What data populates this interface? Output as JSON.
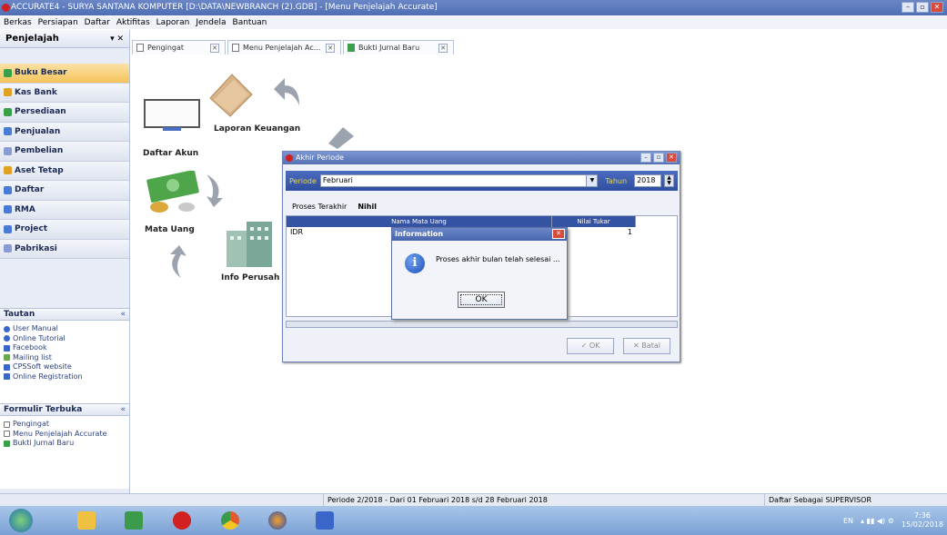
{
  "window": {
    "title": "ACCURATE4 - SURYA SANTANA KOMPUTER  [D:\\DATA\\NEWBRANCH (2).GDB] - [Menu Penjelajah Accurate]"
  },
  "menu": [
    "Berkas",
    "Persiapan",
    "Daftar",
    "Aktifitas",
    "Laporan",
    "Jendela",
    "Bantuan"
  ],
  "sidebar": {
    "title": "Penjelajah",
    "controls": "▾ ✕",
    "items": [
      {
        "label": "Buku Besar",
        "color": "#3aa04a"
      },
      {
        "label": "Kas Bank",
        "color": "#e0a020"
      },
      {
        "label": "Persediaan",
        "color": "#3aa04a"
      },
      {
        "label": "Penjualan",
        "color": "#4a7bd4"
      },
      {
        "label": "Pembelian",
        "color": "#8a9ccf"
      },
      {
        "label": "Aset Tetap",
        "color": "#e0a020"
      },
      {
        "label": "Daftar",
        "color": "#4a7bd4"
      },
      {
        "label": "RMA",
        "color": "#4a7bd4"
      },
      {
        "label": "Project",
        "color": "#4a7bd4"
      },
      {
        "label": "Pabrikasi",
        "color": "#8a9ccf"
      }
    ],
    "tautan": {
      "title": "Tautan",
      "links": [
        "User Manual",
        "Online Tutorial",
        "Facebook",
        "Mailing list",
        "CPSSoft website",
        "Online Registration"
      ]
    },
    "formulir": {
      "title": "Formulir Terbuka",
      "links": [
        "Pengingat",
        "Menu Penjelajah Accurate",
        "Bukti Jurnal Baru"
      ]
    }
  },
  "tabs": [
    "Pengingat",
    "Menu Penjelajah Ac...",
    "Bukti Jurnal Baru"
  ],
  "workspace": {
    "labels": {
      "daftar_akun": "Daftar Akun",
      "laporan_keuangan": "Laporan Keuangan",
      "mata_uang": "Mata Uang",
      "info_perusahaan": "Info Perusah"
    }
  },
  "dialog": {
    "title": "Akhir Periode",
    "periode_label": "Periode",
    "periode_value": "Februari",
    "tahun_label": "Tahun",
    "tahun_value": "2018",
    "proses_label": "Proses Terakhir",
    "proses_value": "Nihil",
    "grid": {
      "columns": [
        "Nama Mata Uang",
        "Nilai Tukar"
      ],
      "rows": [
        {
          "currency": "IDR",
          "rate": "1"
        }
      ]
    },
    "ok_label": "OK",
    "cancel_label": "Batal"
  },
  "info": {
    "title": "Information",
    "message": "Proses akhir bulan telah selesai ...",
    "ok_label": "OK"
  },
  "status": {
    "period": "Periode 2/2018 - Dari 01 Februari 2018 s/d 28 Februari 2018",
    "user": "Daftar Sebagai SUPERVISOR"
  },
  "taskbar": {
    "lang": "EN",
    "time": "7:36",
    "date": "15/02/2018",
    "apps": [
      {
        "name": "start",
        "color": "#2f8f3a"
      },
      {
        "name": "explorer",
        "color": "#f0c040"
      },
      {
        "name": "app-green",
        "color": "#3b9b4a"
      },
      {
        "name": "accurate",
        "color": "#d02020"
      },
      {
        "name": "chrome",
        "color": "#e25b2c"
      },
      {
        "name": "firefox",
        "color": "#e27a20"
      },
      {
        "name": "word",
        "color": "#3a66c9"
      }
    ]
  }
}
